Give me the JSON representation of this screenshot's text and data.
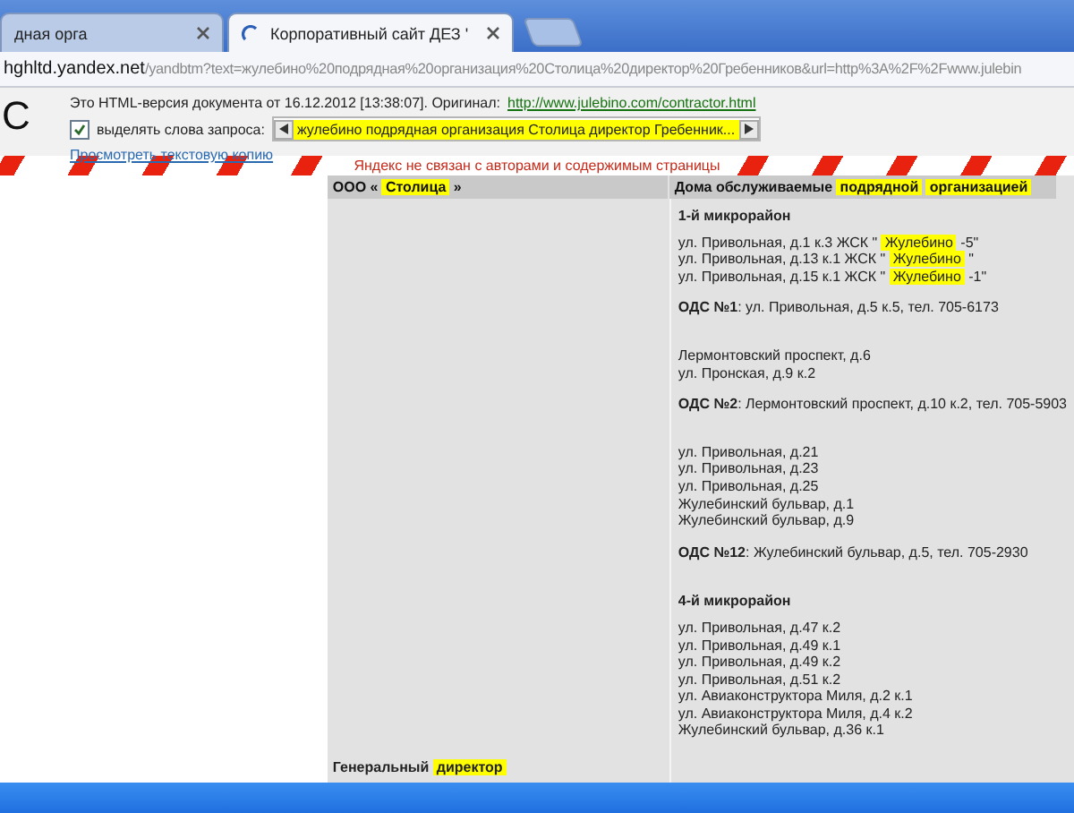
{
  "browser": {
    "tabs": [
      {
        "title": "дная орга",
        "selected": false
      },
      {
        "title": "Корпоративный сайт ДЕЗ '",
        "selected": true
      }
    ],
    "address": {
      "host": "hghltd.yandex.net",
      "path": "/yandbtm?text=жулебино%20подрядная%20организация%20Столица%20директор%20Гребенников&url=http%3A%2F%2Fwww.julebin"
    }
  },
  "cache_header": {
    "logo_letter": "С",
    "notice": "Это HTML-версия документа от 16.12.2012 [13:38:07]. Оригинал:",
    "original_link": "http://www.julebino.com/contractor.html",
    "highlight_toggle": {
      "label": "выделять слова запроса:",
      "checked": true
    },
    "query": "жулебино подрядная организация Столица директор Гребенник...",
    "text_copy_link": "Просмотреть текстовую копию"
  },
  "disclaimer": "Яндекс не связан с авторами и содержимым страницы",
  "table": {
    "columns": [
      [
        {
          "text": "ООО « ",
          "highlight": false
        },
        {
          "text": "Столица",
          "highlight": true
        },
        {
          "text": " »",
          "highlight": false
        }
      ],
      [
        {
          "text": "Дома обслуживаемые ",
          "highlight": false
        },
        {
          "text": "подрядной",
          "highlight": true
        },
        {
          "text": " ",
          "highlight": false
        },
        {
          "text": "организацией",
          "highlight": true
        }
      ]
    ],
    "left_cell": [
      {
        "text": "Генеральный ",
        "highlight": false
      },
      {
        "text": "директор",
        "highlight": true
      }
    ],
    "blocks": [
      {
        "kind": "heading",
        "text": "1-й микрорайон"
      },
      {
        "kind": "addresses",
        "lines": [
          [
            {
              "text": "ул. Привольная, д.1 к.3 ЖСК \" ",
              "highlight": false
            },
            {
              "text": "Жулебино",
              "highlight": true
            },
            {
              "text": " -5\"",
              "highlight": false
            }
          ],
          [
            {
              "text": "ул. Привольная, д.13 к.1 ЖСК \" ",
              "highlight": false
            },
            {
              "text": "Жулебино",
              "highlight": true
            },
            {
              "text": " \"",
              "highlight": false
            }
          ],
          [
            {
              "text": "ул. Привольная, д.15 к.1 ЖСК \" ",
              "highlight": false
            },
            {
              "text": "Жулебино",
              "highlight": true
            },
            {
              "text": " -1\"",
              "highlight": false
            }
          ]
        ]
      },
      {
        "kind": "ods",
        "text": "**ОДС №1**: ул. Привольная, д.5 к.5, тел. 705-6173"
      },
      {
        "kind": "addresses",
        "lines": [
          [
            {
              "text": "Лермонтовский проспект, д.6",
              "highlight": false
            }
          ],
          [
            {
              "text": "ул. Пронская, д.9 к.2",
              "highlight": false
            }
          ]
        ]
      },
      {
        "kind": "ods",
        "text": "**ОДС №2**: Лермонтовский проспект, д.10 к.2, тел. 705-5903"
      },
      {
        "kind": "addresses",
        "lines": [
          [
            {
              "text": "ул. Привольная, д.21",
              "highlight": false
            }
          ],
          [
            {
              "text": "ул. Привольная, д.23",
              "highlight": false
            }
          ],
          [
            {
              "text": "ул. Привольная, д.25",
              "highlight": false
            }
          ],
          [
            {
              "text": "Жулебинский бульвар, д.1",
              "highlight": false
            }
          ],
          [
            {
              "text": "Жулебинский бульвар, д.9",
              "highlight": false
            }
          ]
        ]
      },
      {
        "kind": "ods",
        "text": "**ОДС №12**: Жулебинский бульвар, д.5, тел. 705-2930"
      },
      {
        "kind": "heading",
        "text": "4-й микрорайон"
      },
      {
        "kind": "addresses",
        "lines": [
          [
            {
              "text": "ул. Привольная, д.47 к.2",
              "highlight": false
            }
          ],
          [
            {
              "text": "ул. Привольная, д.49 к.1",
              "highlight": false
            }
          ],
          [
            {
              "text": "ул. Привольная, д.49 к.2",
              "highlight": false
            }
          ],
          [
            {
              "text": "ул. Привольная, д.51 к.2",
              "highlight": false
            }
          ],
          [
            {
              "text": "ул. Авиаконструктора Миля, д.2 к.1",
              "highlight": false
            }
          ],
          [
            {
              "text": "ул. Авиаконструктора Миля, д.4 к.2",
              "highlight": false
            }
          ],
          [
            {
              "text": "Жулебинский бульвар, д.36 к.1",
              "highlight": false
            }
          ]
        ]
      }
    ]
  }
}
